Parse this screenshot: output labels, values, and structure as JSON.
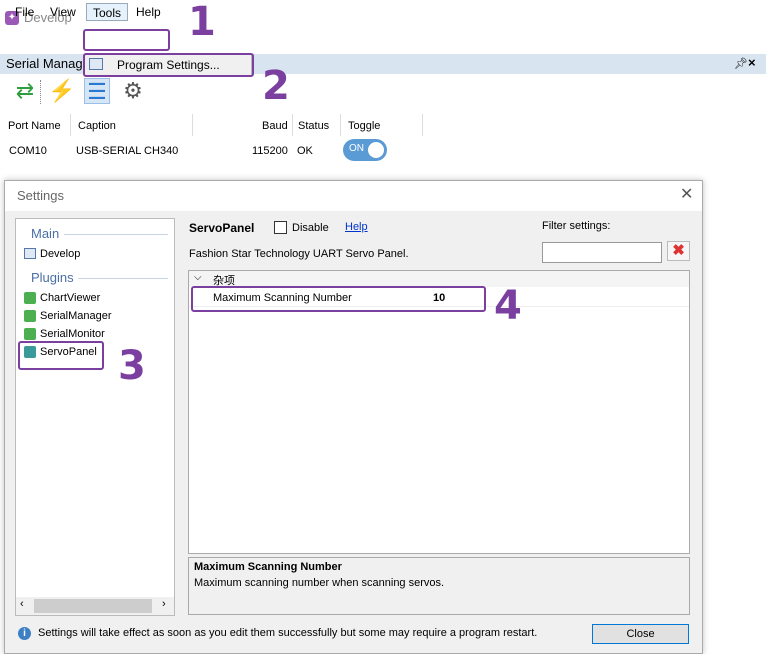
{
  "app": {
    "title": "Develop",
    "icon": "app-logo-icon"
  },
  "menu": [
    "File",
    "View",
    "Tools",
    "Help"
  ],
  "dropdown": {
    "item_label": "Program Settings..."
  },
  "panel": {
    "title": "Serial Manag",
    "pin_icon": "pin-icon",
    "close_icon": "close-icon"
  },
  "toolbar": {
    "icons": [
      "refresh-icon",
      "connect-plug-icon",
      "list-icon",
      "settings-gear-icon"
    ]
  },
  "table": {
    "headers": [
      "Port Name",
      "Caption",
      "Baud",
      "Status",
      "Toggle"
    ],
    "rows": [
      {
        "port": "COM10",
        "caption": "USB-SERIAL CH340",
        "baud": "115200",
        "status": "OK",
        "toggle": "ON"
      }
    ]
  },
  "settings": {
    "title": "Settings",
    "nav": {
      "main_section": "Main",
      "main_items": [
        "Develop"
      ],
      "plugins_section": "Plugins",
      "plugin_items": [
        "ChartViewer",
        "SerialManager",
        "SerialMonitor",
        "ServoPanel"
      ]
    },
    "panel_title": "ServoPanel",
    "disable_label": "Disable",
    "help_link": "Help",
    "description": "Fashion Star Technology UART Servo Panel.",
    "filter_label": "Filter settings:",
    "filter_value": "",
    "category": "杂项",
    "properties": [
      {
        "name": "Maximum Scanning Number",
        "value": "10"
      }
    ],
    "help_title": "Maximum Scanning Number",
    "help_text": "Maximum scanning number when scanning servos.",
    "info_text": "Settings will take effect as soon as you edit them successfully but some may require a program restart.",
    "close_label": "Close"
  },
  "annotations": [
    "1",
    "2",
    "3",
    "4"
  ],
  "colors": {
    "annotation": "#7b3fa0",
    "accent": "#5b9bd5"
  }
}
